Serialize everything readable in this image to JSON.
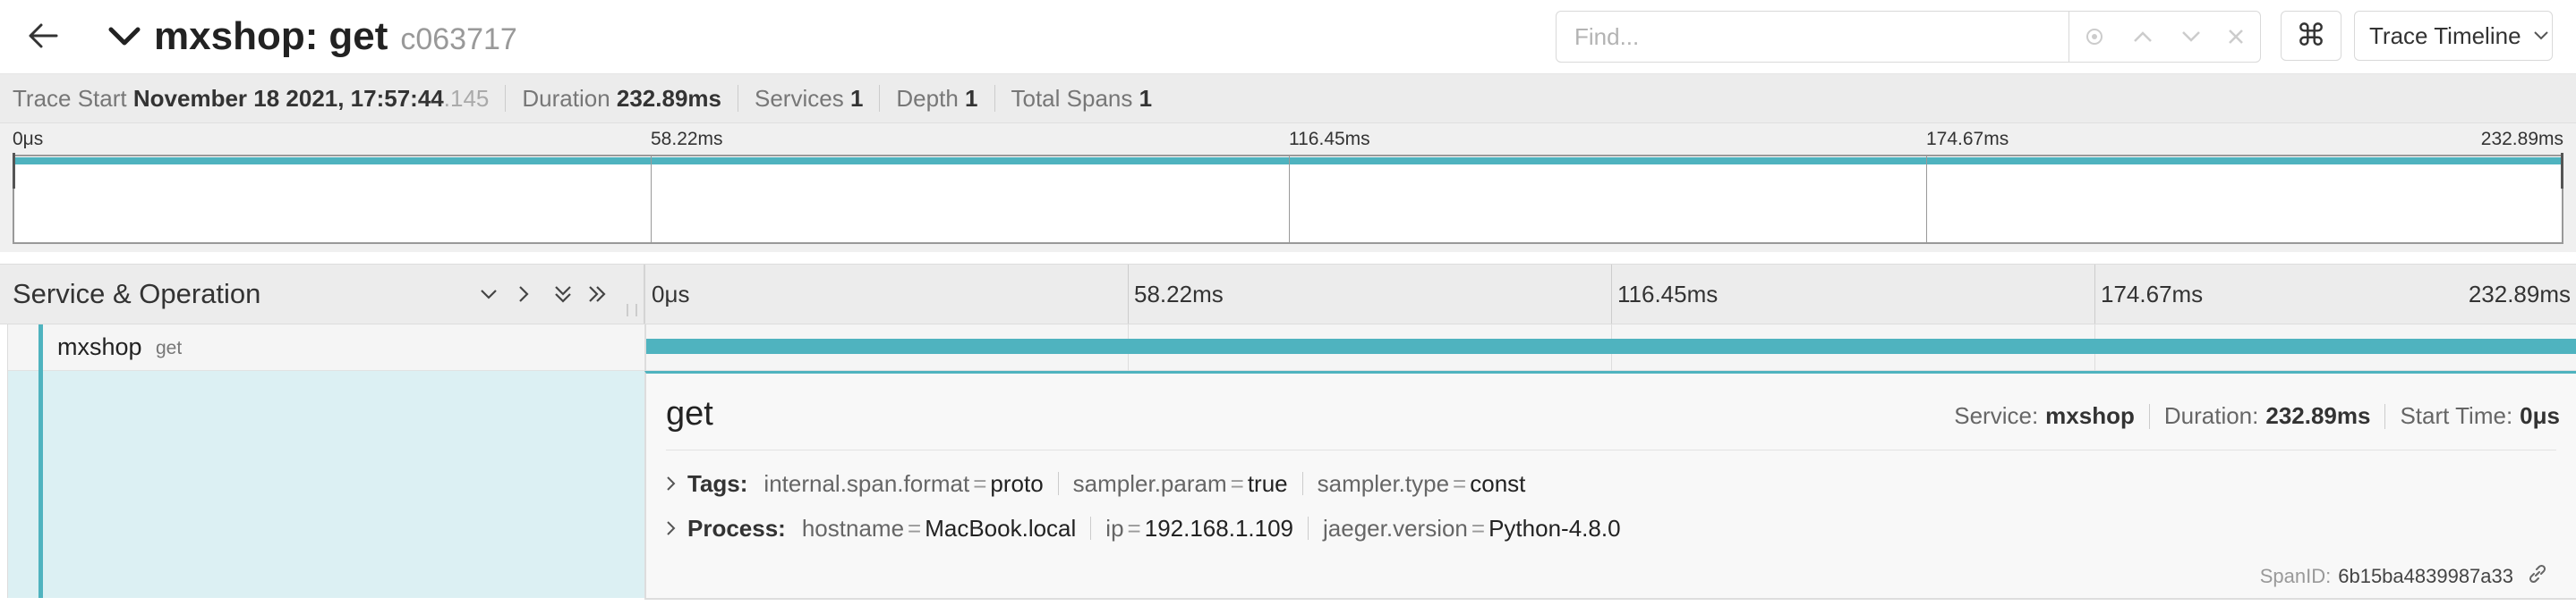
{
  "header": {
    "service": "mxshop:",
    "operation": "get",
    "trace_id_short": "c063717",
    "find_placeholder": "Find...",
    "shortcut_glyph": "⌘",
    "view_select": "Trace Timeline"
  },
  "summary": {
    "trace_start_label": "Trace Start",
    "trace_start_value": "November 18 2021, 17:57:44",
    "trace_start_ms": ".145",
    "duration_label": "Duration",
    "duration_value": "232.89ms",
    "services_label": "Services",
    "services_value": "1",
    "depth_label": "Depth",
    "depth_value": "1",
    "total_spans_label": "Total Spans",
    "total_spans_value": "1"
  },
  "ticks": [
    "0μs",
    "58.22ms",
    "116.45ms",
    "174.67ms",
    "232.89ms"
  ],
  "span_header": {
    "title": "Service & Operation"
  },
  "span_row": {
    "service": "mxshop",
    "operation": "get",
    "start_fraction": 0.0,
    "duration_fraction": 1.0
  },
  "detail": {
    "operation": "get",
    "service_label": "Service:",
    "service_value": "mxshop",
    "duration_label": "Duration:",
    "duration_value": "232.89ms",
    "start_label": "Start Time:",
    "start_value": "0μs",
    "tags_label": "Tags:",
    "tags": [
      {
        "key": "internal.span.format",
        "value": "proto"
      },
      {
        "key": "sampler.param",
        "value": "true"
      },
      {
        "key": "sampler.type",
        "value": "const"
      }
    ],
    "process_label": "Process:",
    "process": [
      {
        "key": "hostname",
        "value": "MacBook.local"
      },
      {
        "key": "ip",
        "value": "192.168.1.109"
      },
      {
        "key": "jaeger.version",
        "value": "Python-4.8.0"
      }
    ],
    "spanid_label": "SpanID:",
    "spanid_value": "6b15ba4839987a33"
  },
  "colors": {
    "accent": "#4fb3bf",
    "detail_bg": "#dcf0f3"
  }
}
